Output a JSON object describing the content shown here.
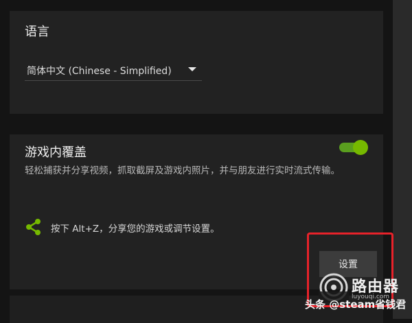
{
  "language_section": {
    "title": "语言",
    "selected_language": "简体中文 (Chinese - Simplified)"
  },
  "overlay_section": {
    "title": "游戏内覆盖",
    "toggle_on": true,
    "description": "轻松捕获并分享视频，抓取截屏及游戏内照片，并与朋友进行实时流式传输。",
    "hint": "按下 Alt+Z，分享您的游戏或调节设置。",
    "settings_button_label": "设置"
  },
  "colors": {
    "accent_green": "#76b900",
    "highlight_red": "#e8222a",
    "card_bg": "#222222",
    "page_bg": "#141414"
  },
  "icons": {
    "share": "share-icon",
    "dropdown": "chevron-down-icon",
    "watermark": "router-logo-icon"
  },
  "watermark": {
    "brand": "路由器",
    "url": "luyouqi.com",
    "credit": "头条 @steam省钱君"
  }
}
